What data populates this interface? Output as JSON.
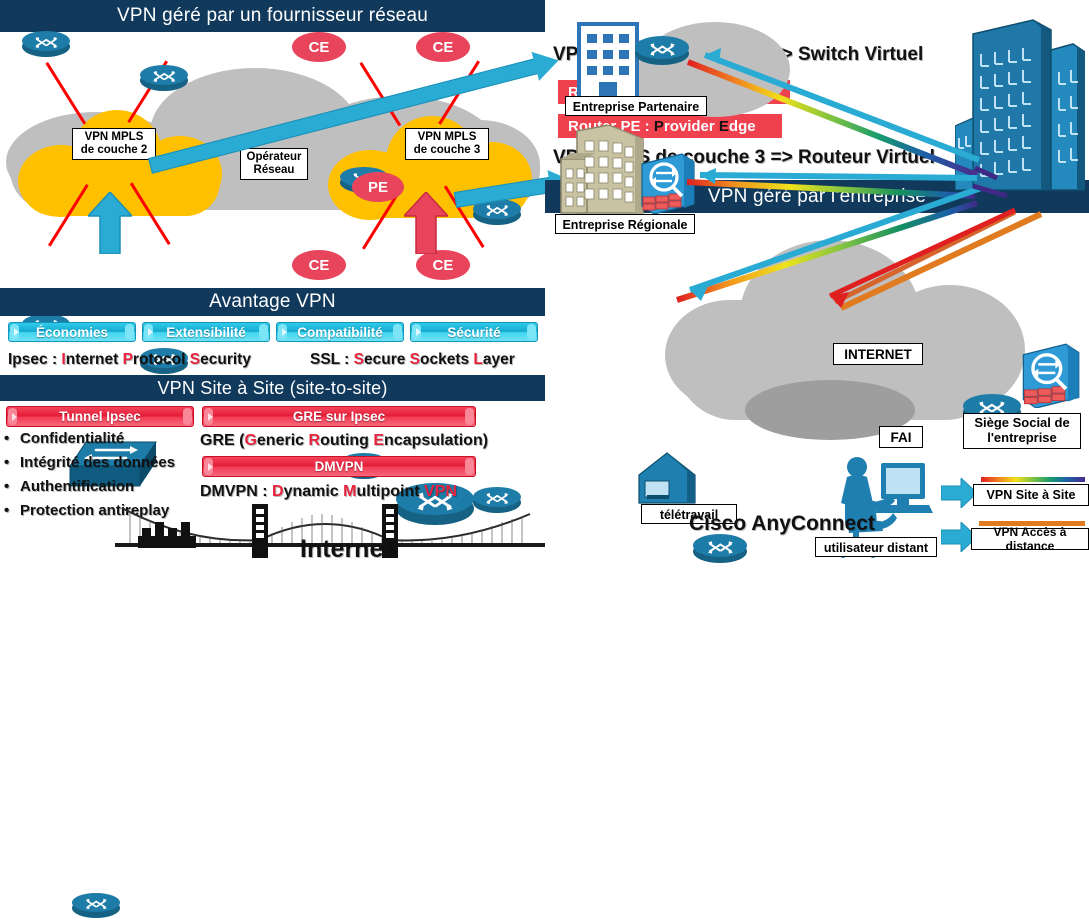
{
  "left": {
    "header": "VPN géré par un fournisseur réseau",
    "mpls_l2_label": "VPN MPLS\nde couche 2",
    "mpls_l2_line1": "VPN MPLS",
    "mpls_l2_line2": "de couche 2",
    "mpls_l3_line1": "VPN MPLS",
    "mpls_l3_line2": "de couche 3",
    "operator_line1": "Opérateur",
    "operator_line2": "Réseau",
    "ce_badges": [
      "CE",
      "CE",
      "CE",
      "CE"
    ],
    "pe_badge": "PE",
    "advantage_header": "Avantage VPN",
    "advantages": [
      "Économies",
      "Extensibilité",
      "Compatibilité",
      "Sécurité"
    ],
    "ipsec_def": {
      "prefix": "Ipsec : ",
      "i": "I",
      "nternet": "nternet ",
      "p": "P",
      "rotocol": "rotocol ",
      "s": "S",
      "ecurity": "ecurity"
    },
    "ssl_def": {
      "prefix": "SSL : ",
      "s1": "S",
      "ecure": "ecure ",
      "s2": "S",
      "ockets": "ockets ",
      "l": "L",
      "ayer": "ayer"
    },
    "site_header": "VPN Site à Site (site-to-site)",
    "tunnel_pill": "Tunnel Ipsec",
    "gre_pill": "GRE sur Ipsec",
    "dmvpn_pill": "DMVPN",
    "tunnel_bullets": [
      "Confidentialité",
      "Intégrité des données",
      "Authentification",
      "Protection antireplay"
    ],
    "gre_def": {
      "head": "GRE (",
      "g": "G",
      "eneric": "eneric ",
      "r": "R",
      "outing": "outing ",
      "e": "E",
      "ncapsulation": "ncapsulation)"
    },
    "dmvpn_def": {
      "head": "DMVPN : ",
      "d": "D",
      "ynamic": "ynamic ",
      "m": "M",
      "ultipoint": "ultipoint ",
      "vpn": "VPN"
    },
    "internet_label": "Internet"
  },
  "right": {
    "callout_l2": "VPN MPLS de couche 2 => Switch Virtuel",
    "callout_l3": "VPN MPLS de couche 3 => Routeur Virtuel",
    "router_ce": {
      "head": "Router CE : ",
      "c": "C",
      "ustomer": "ustomer ",
      "e": "E",
      "dge": "dge"
    },
    "router_pe": {
      "head": "Router PE : ",
      "p": "P",
      "rovider": "rovider ",
      "e": "E",
      "dge": "dge"
    },
    "header": "VPN géré par l’entreprise",
    "partner_label": "Entreprise Partenaire",
    "regional_label": "Entreprise Régionale",
    "internet_label": "INTERNET",
    "isp_label": "FAI",
    "hq_line1": "Siège Social de",
    "hq_line2": "l'entreprise",
    "telework_label": "télétravail",
    "remote_user_label": "utilisateur distant",
    "anyconnect_label": "Cisco AnyConnect",
    "legend": [
      {
        "label": "VPN Site à Site",
        "style": "rainbow"
      },
      {
        "label": "VPN Accès à distance",
        "style": "orange"
      }
    ]
  },
  "colors": {
    "navy": "#10395B",
    "cyan": "#29ABD4",
    "red": "#E8455C",
    "yellow": "#FFC000",
    "gray_cloud": "#BFBFBF",
    "cisco_blue": "#1E7CA8",
    "pill_red": "#E31B35",
    "highlight_red": "#E8233E",
    "orange": "#E07B20"
  }
}
